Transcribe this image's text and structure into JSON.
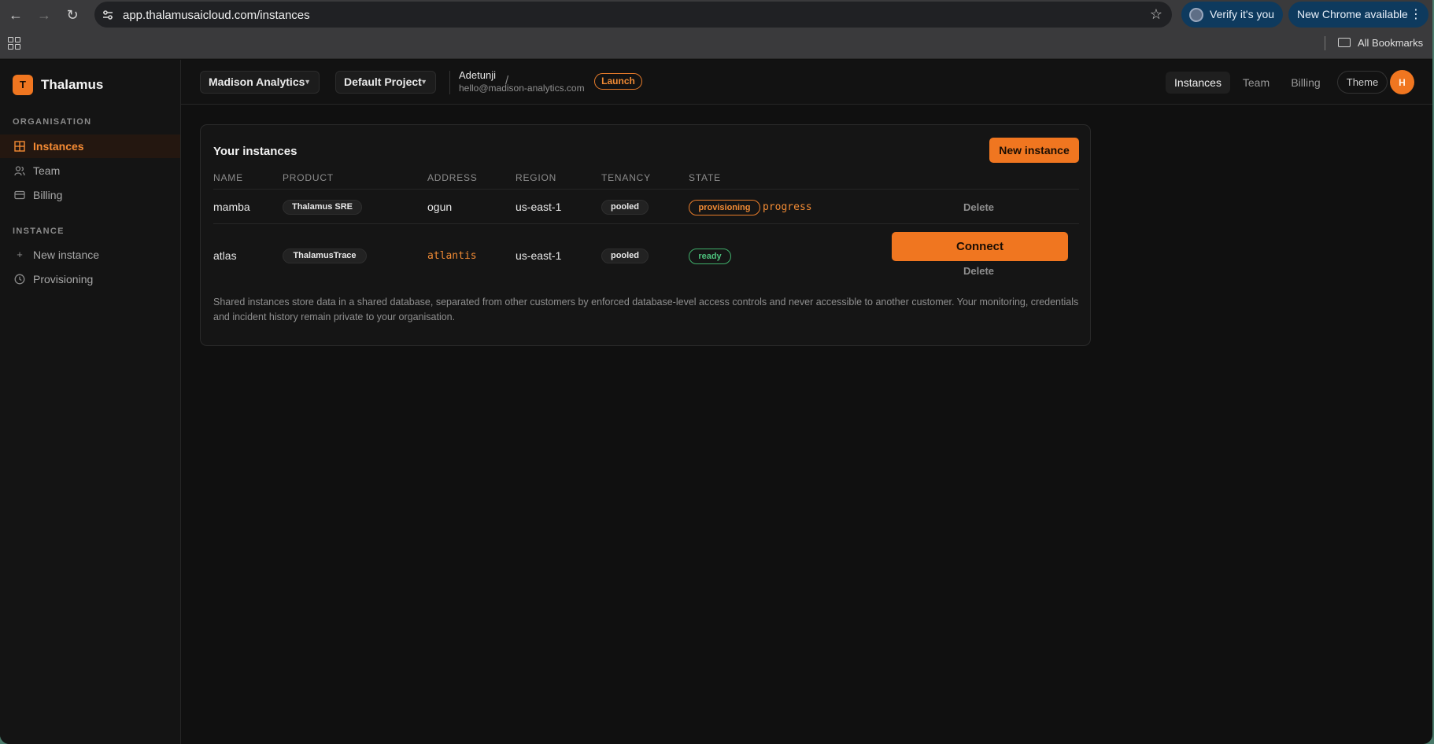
{
  "browser": {
    "url": "app.thalamusaicloud.com/instances",
    "verify_label": "Verify it's you",
    "update_label": "New Chrome available",
    "bookmarks_label": "All Bookmarks",
    "icons": [
      "back-icon",
      "forward-icon",
      "reload-icon",
      "site-settings-icon",
      "star-icon",
      "apps-icon",
      "folder-icon",
      "kebab-icon"
    ]
  },
  "sidebar": {
    "logo_letter": "T",
    "app_name": "Thalamus",
    "sections": [
      {
        "label": "ORGANISATION",
        "items": [
          {
            "label": "Instances",
            "icon": "grid-icon",
            "active": true
          },
          {
            "label": "Team",
            "icon": "users-icon"
          },
          {
            "label": "Billing",
            "icon": "card-icon"
          }
        ]
      },
      {
        "label": "INSTANCE",
        "items": [
          {
            "label": "New instance",
            "icon": "plus-icon"
          },
          {
            "label": "Provisioning",
            "icon": "clock-icon"
          }
        ]
      }
    ]
  },
  "topbar": {
    "org": "Madison Analytics",
    "project": "Default Project",
    "separator": "/",
    "user_name": "Adetunji",
    "user_email": "hello@madison-analytics.com",
    "plan_badge": "Launch",
    "tabs": [
      {
        "label": "Instances",
        "active": true
      },
      {
        "label": "Team"
      },
      {
        "label": "Billing"
      }
    ],
    "theme_label": "Theme",
    "avatar_letter": "H"
  },
  "instances": {
    "title": "Your instances",
    "new_button": "New instance",
    "columns": [
      "NAME",
      "PRODUCT",
      "ADDRESS",
      "REGION",
      "TENANCY",
      "STATE"
    ],
    "rows": [
      {
        "name": "mamba",
        "product": "Thalamus SRE",
        "address": "ogun",
        "region": "us-east-1",
        "tenancy": "pooled",
        "state": "provisioning",
        "progress": "progress",
        "delete": "Delete"
      },
      {
        "name": "atlas",
        "product": "ThalamusTrace",
        "address": "atlantis",
        "region": "us-east-1",
        "tenancy": "pooled",
        "state": "ready",
        "connect": "Connect",
        "delete": "Delete"
      }
    ],
    "note": "Shared instances store data in a shared database, separated from other customers by enforced database-level access controls and never accessible to another customer. Your monitoring, credentials and incident history remain private to your organisation."
  },
  "colors": {
    "accent": "#f07620",
    "ready": "#4dc27c",
    "background": "#101010"
  }
}
